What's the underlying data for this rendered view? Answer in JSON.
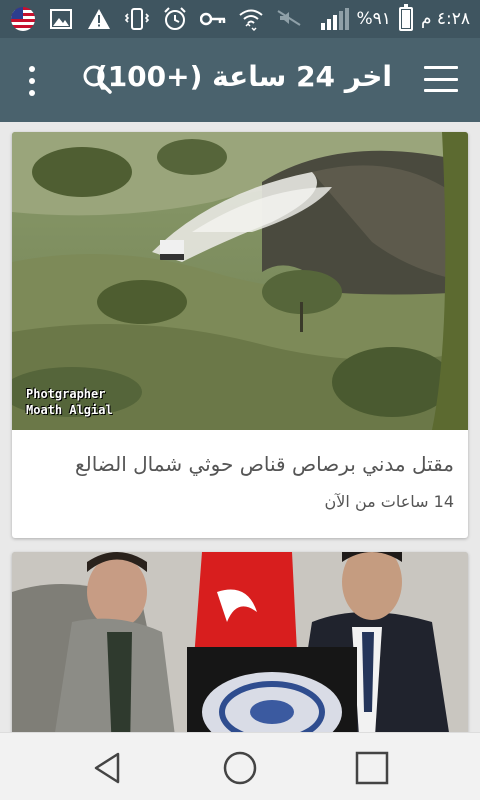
{
  "status_bar": {
    "time": "٤:٢٨ م",
    "battery": "%٩١",
    "battery_level": 0.91,
    "icons": [
      "us-flag-icon",
      "image-icon",
      "warning-icon",
      "vibrate-icon",
      "alarm-icon",
      "key-icon",
      "wifi-icon",
      "mute-icon",
      "signal-icon",
      "battery-icon"
    ]
  },
  "app_bar": {
    "title": "اخر 24 ساعة (+100)",
    "icons": [
      "menu-icon",
      "search-icon",
      "more-vertical-icon"
    ]
  },
  "articles": [
    {
      "title": "مقتل مدني برصاص قناص حوثي شمال الضالع",
      "time": "14 ساعات من الآن",
      "photo_credit": "Photgrapher Moath Algial"
    },
    {
      "title": "",
      "time": ""
    }
  ],
  "nav_bar": {
    "icons": [
      "back-icon",
      "home-icon",
      "recents-icon"
    ]
  },
  "colors": {
    "status_bar": "#3f5560",
    "app_bar": "#4a626d",
    "background": "#e9e9e9",
    "card": "#ffffff",
    "text": "#555555"
  }
}
